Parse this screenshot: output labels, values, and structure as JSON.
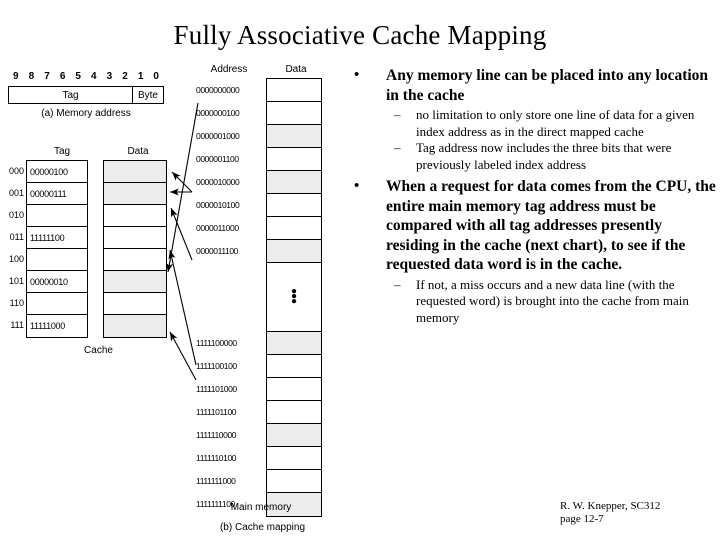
{
  "slide": {
    "title": "Fully Associative Cache Mapping",
    "footer_line1": "R. W. Knepper, SC312",
    "footer_line2": "page 12-7"
  },
  "figure": {
    "bit_numbers": [
      "9",
      "8",
      "7",
      "6",
      "5",
      "4",
      "3",
      "2",
      "1",
      "0"
    ],
    "address_fields": {
      "tag": "Tag",
      "byte": "Byte"
    },
    "caption_a": "(a) Memory address",
    "caption_cache": "Cache",
    "caption_main_memory": "Main memory",
    "caption_b": "(b) Cache mapping",
    "cache_header_tag": "Tag",
    "cache_header_data": "Data",
    "memory_header_address": "Address",
    "memory_header_data": "Data",
    "cache_rows": [
      {
        "index": "000",
        "tag": "00000100",
        "data_filled": true
      },
      {
        "index": "001",
        "tag": "00000111",
        "data_filled": true
      },
      {
        "index": "010",
        "tag": "",
        "data_filled": false
      },
      {
        "index": "011",
        "tag": "11111100",
        "data_filled": false
      },
      {
        "index": "100",
        "tag": "",
        "data_filled": false
      },
      {
        "index": "101",
        "tag": "00000010",
        "data_filled": true
      },
      {
        "index": "110",
        "tag": "",
        "data_filled": false
      },
      {
        "index": "111",
        "tag": "11111000",
        "data_filled": true
      }
    ],
    "memory_rows": [
      {
        "address": "0000000000",
        "filled": false
      },
      {
        "address": "0000000100",
        "filled": false
      },
      {
        "address": "0000001000",
        "filled": true
      },
      {
        "address": "0000001100",
        "filled": false
      },
      {
        "address": "0000010000",
        "filled": true
      },
      {
        "address": "0000010100",
        "filled": false
      },
      {
        "address": "0000011000",
        "filled": false
      },
      {
        "address": "0000011100",
        "filled": true
      },
      {
        "address": "",
        "filled": false,
        "ellipsis": true
      },
      {
        "address": "1111100000",
        "filled": true
      },
      {
        "address": "1111100100",
        "filled": false
      },
      {
        "address": "1111101000",
        "filled": false
      },
      {
        "address": "1111101100",
        "filled": false
      },
      {
        "address": "1111110000",
        "filled": true
      },
      {
        "address": "1111110100",
        "filled": false
      },
      {
        "address": "1111111000",
        "filled": false
      },
      {
        "address": "1111111100",
        "filled": true
      }
    ],
    "vertical_ellipsis": "•"
  },
  "content": {
    "bullet_char": "•",
    "dash_char": "–",
    "bullets": [
      {
        "text": "Any memory line can be placed into any location in the cache",
        "subs": [
          "no limitation to only store one line of data for a given index address as in the direct mapped cache",
          "Tag address now includes the three bits that were previously labeled index address"
        ]
      },
      {
        "text": "When a request for data comes from the CPU, the entire main memory tag address must be compared with all tag addresses presently residing in the cache (next chart), to see if the requested data word is in the cache.",
        "subs": [
          "If not, a miss occurs and a new data line (with the requested word) is brought into the cache from main memory"
        ]
      }
    ]
  }
}
